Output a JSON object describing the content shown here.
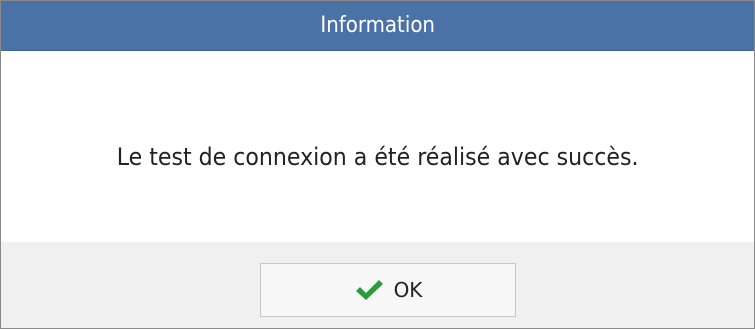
{
  "dialog": {
    "title": "Information",
    "message": "Le test de connexion a été réalisé avec succès.",
    "ok_button": {
      "label": "OK",
      "icon": "checkmark-icon"
    }
  },
  "colors": {
    "titlebar": "#4a72a7",
    "footer": "#f0f0f0",
    "checkmark": "#2e9a3e"
  }
}
